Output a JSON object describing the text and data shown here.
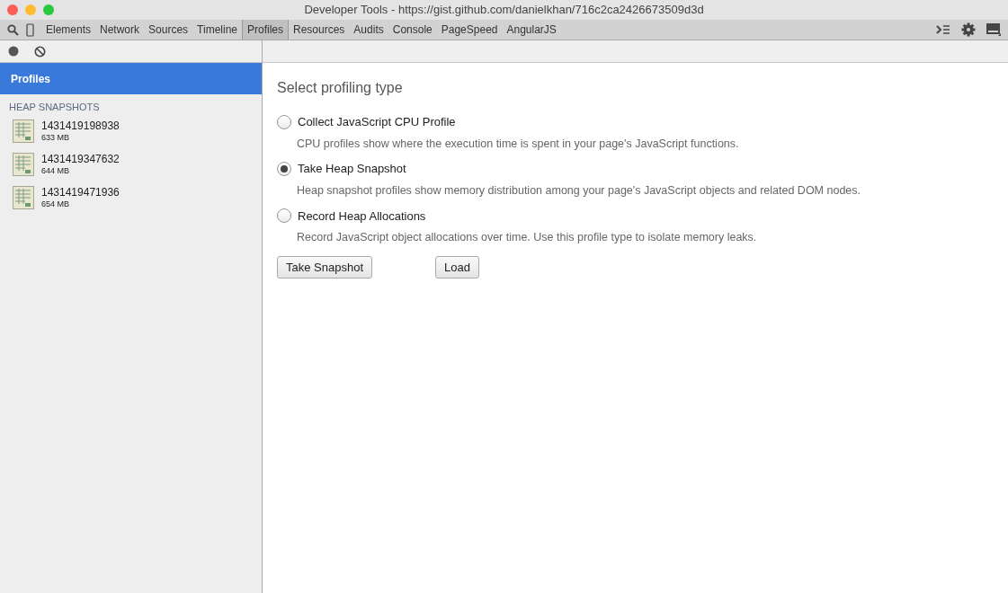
{
  "window": {
    "title": "Developer Tools - https://gist.github.com/danielkhan/716c2ca2426673509d3d"
  },
  "tabs": [
    {
      "label": "Elements",
      "selected": false
    },
    {
      "label": "Network",
      "selected": false
    },
    {
      "label": "Sources",
      "selected": false
    },
    {
      "label": "Timeline",
      "selected": false
    },
    {
      "label": "Profiles",
      "selected": true
    },
    {
      "label": "Resources",
      "selected": false
    },
    {
      "label": "Audits",
      "selected": false
    },
    {
      "label": "Console",
      "selected": false
    },
    {
      "label": "PageSpeed",
      "selected": false
    },
    {
      "label": "AngularJS",
      "selected": false
    }
  ],
  "sidebar": {
    "header": {
      "label": "Profiles",
      "selected": true
    },
    "section": "HEAP SNAPSHOTS",
    "items": [
      {
        "name": "1431419198938",
        "size": "633 MB"
      },
      {
        "name": "1431419347632",
        "size": "644 MB"
      },
      {
        "name": "1431419471936",
        "size": "654 MB"
      }
    ]
  },
  "main": {
    "heading": "Select profiling type",
    "options": [
      {
        "label": "Collect JavaScript CPU Profile",
        "description": "CPU profiles show where the execution time is spent in your page's JavaScript functions.",
        "selected": false
      },
      {
        "label": "Take Heap Snapshot",
        "description": "Heap snapshot profiles show memory distribution among your page's JavaScript objects and related DOM nodes.",
        "selected": true
      },
      {
        "label": "Record Heap Allocations",
        "description": "Record JavaScript object allocations over time. Use this profile type to isolate memory leaks.",
        "selected": false
      }
    ],
    "buttons": [
      "Take Snapshot",
      "Load"
    ]
  }
}
